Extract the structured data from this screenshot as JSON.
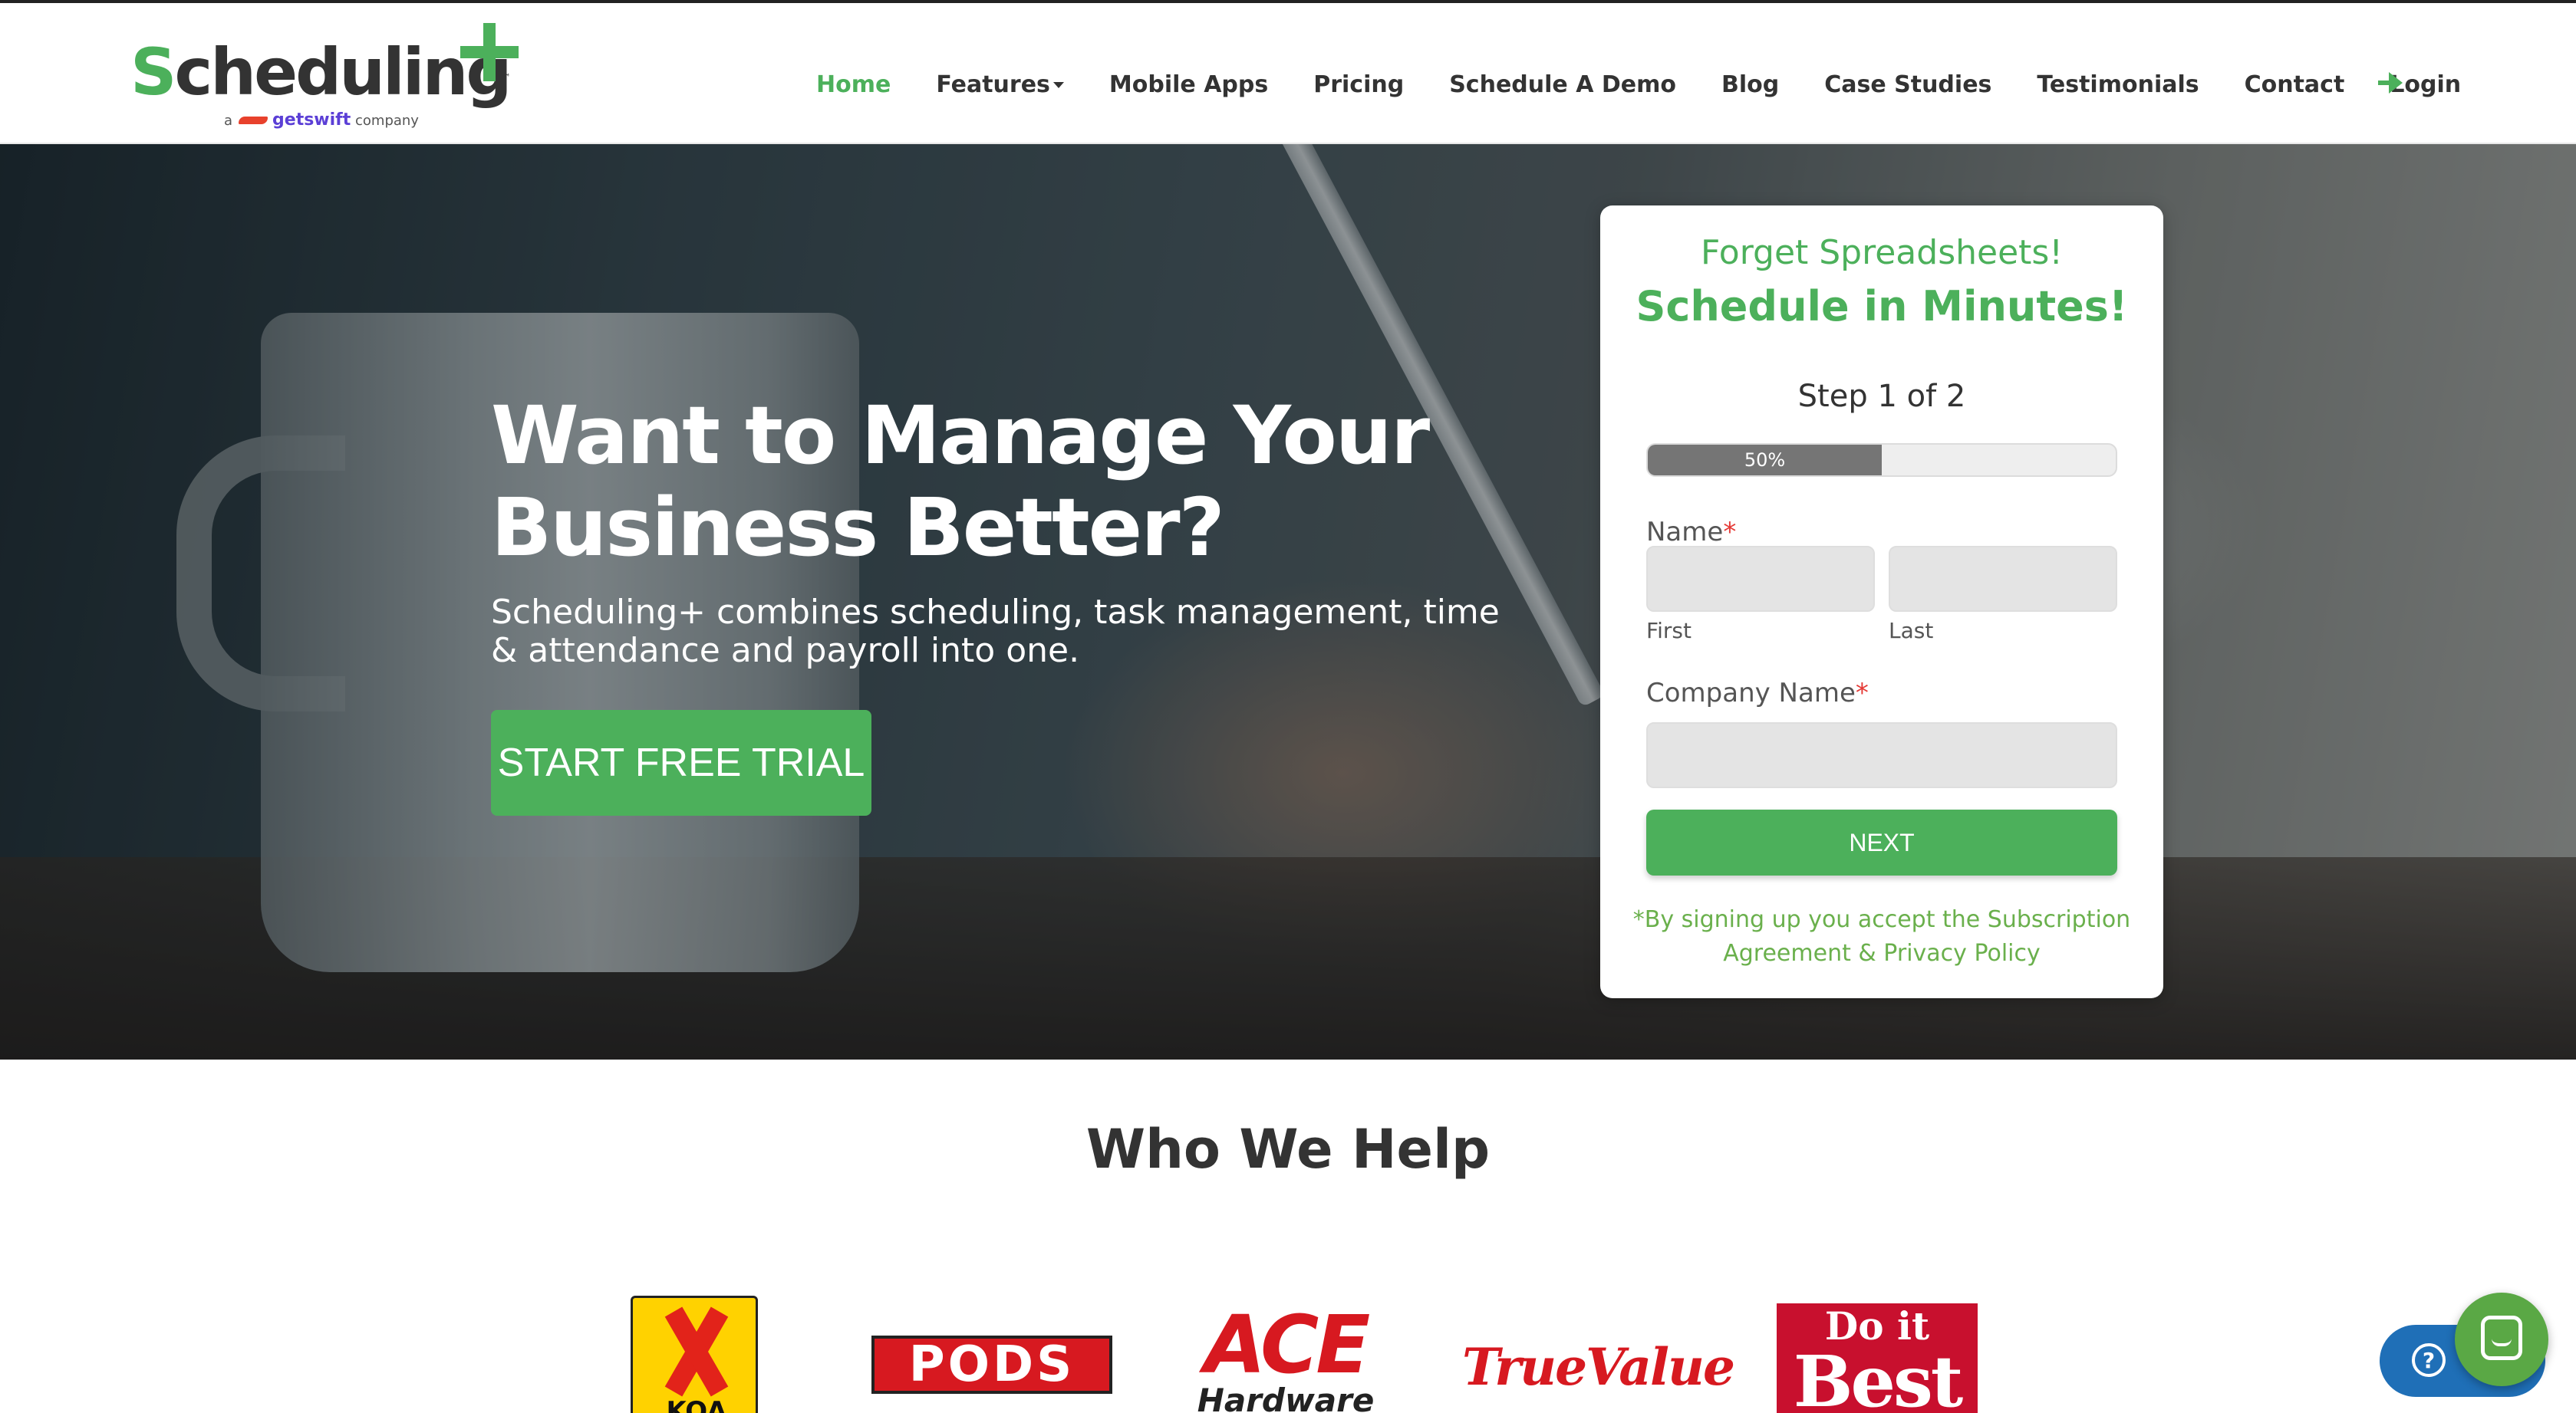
{
  "header": {
    "logo": {
      "word": "Scheduling",
      "tagline_prefix": "a",
      "tagline_brand": "getswift",
      "tagline_suffix": "company"
    },
    "nav": [
      {
        "label": "Home",
        "active": true
      },
      {
        "label": "Features",
        "dropdown": true
      },
      {
        "label": "Mobile Apps"
      },
      {
        "label": "Pricing"
      },
      {
        "label": "Schedule A Demo"
      },
      {
        "label": "Blog"
      },
      {
        "label": "Case Studies"
      },
      {
        "label": "Testimonials"
      },
      {
        "label": "Contact"
      },
      {
        "label": "Login"
      }
    ],
    "login_icon": "arrow-right-icon"
  },
  "hero": {
    "title": "Want to Manage Your Business Better?",
    "subtitle": "Scheduling+ combines scheduling, task management, time & attendance and payroll into one.",
    "cta_label": "START FREE TRIAL"
  },
  "form": {
    "headline1": "Forget Spreadsheets!",
    "headline2": "Schedule in Minutes!",
    "step": "Step 1 of 2",
    "progress_percent": 50,
    "progress_label": "50%",
    "name_label": "Name",
    "required_mark": "*",
    "first_label": "First",
    "last_label": "Last",
    "first_value": "",
    "last_value": "",
    "company_label": "Company Name",
    "company_value": "",
    "next_label": "NEXT",
    "terms": "*By signing up you accept the Subscription Agreement & Privacy Policy"
  },
  "who_we_help": {
    "title": "Who We Help",
    "logos": [
      {
        "name": "KOA",
        "text": "KOA"
      },
      {
        "name": "PODS",
        "text": "PODS"
      },
      {
        "name": "ACE Hardware",
        "text1": "ACE",
        "text2": "Hardware"
      },
      {
        "name": "True Value",
        "text": "TrueValue"
      },
      {
        "name": "Do it Best",
        "text1": "Do it",
        "text2": "Best"
      }
    ]
  },
  "widgets": {
    "help_icon": "question-circle-icon",
    "chat_icon": "chat-bubble-icon"
  },
  "colors": {
    "brand_green": "#4cb05b",
    "text_dark": "#333333",
    "required_red": "#e53935",
    "help_blue": "#1f6fb7"
  }
}
